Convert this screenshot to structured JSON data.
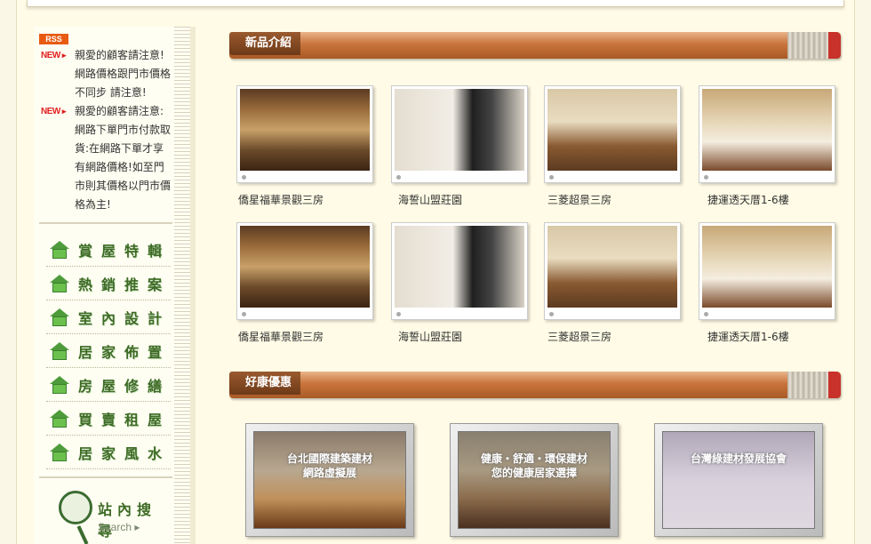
{
  "sidebar": {
    "rss_label": "RSS",
    "news_badge": "NEW",
    "news": [
      "親愛的顧客請注意!網路價格跟門市價格不同步 請注意!",
      "親愛的顧客請注意:網路下單門市付款取貨:在網路下單才享有網路價格!如至門市則其價格以門市價格為主!"
    ],
    "menu": [
      {
        "label": "賞屋特輯",
        "icon": "house-icon"
      },
      {
        "label": "熱銷推案",
        "icon": "house-icon"
      },
      {
        "label": "室內設計",
        "icon": "house-icon"
      },
      {
        "label": "居家佈置",
        "icon": "house-icon"
      },
      {
        "label": "房屋修繕",
        "icon": "house-icon"
      },
      {
        "label": "買賣租屋",
        "icon": "house-icon"
      },
      {
        "label": "居家風水",
        "icon": "house-icon"
      }
    ],
    "search_label": "站內搜尋",
    "search_sub": "Search ▸"
  },
  "new_products": {
    "title": "新品介紹",
    "items": [
      {
        "name": "僑星福華景觀三房"
      },
      {
        "name": "海誓山盟莊園"
      },
      {
        "name": "三菱超景三房"
      },
      {
        "name": "捷運透天厝1-6樓"
      },
      {
        "name": "僑星福華景觀三房"
      },
      {
        "name": "海誓山盟莊園"
      },
      {
        "name": "三菱超景三房"
      },
      {
        "name": "捷運透天厝1-6樓"
      }
    ]
  },
  "promotions": {
    "title": "好康優惠",
    "items": [
      {
        "line1": "台北國際建築建材",
        "line2": "網路虛擬展"
      },
      {
        "line1": "健康・舒適・環保建材",
        "line2": "您的健康居家選擇"
      },
      {
        "line1": "台灣綠建材發展協會",
        "line2": ""
      }
    ]
  }
}
